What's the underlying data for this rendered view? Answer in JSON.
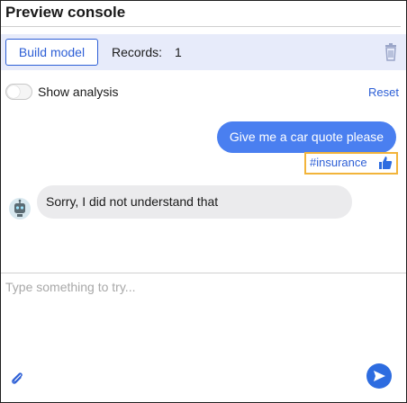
{
  "panel": {
    "title": "Preview console"
  },
  "toolbar": {
    "build_label": "Build model",
    "records_label": "Records:",
    "records_count": "1",
    "delete_icon": "trash-icon"
  },
  "analysis": {
    "toggle_label": "Show analysis",
    "toggle_on": false,
    "reset_label": "Reset"
  },
  "conversation": {
    "user_message": "Give me a car quote please",
    "intent_tag": "#insurance",
    "intent_icon": "thumbs-up-icon",
    "bot_message": "Sorry, I did not understand that",
    "bot_icon": "robot-avatar-icon"
  },
  "composer": {
    "placeholder": "Type something to try...",
    "attach_icon": "paperclip-icon",
    "send_icon": "send-icon"
  },
  "colors": {
    "accent": "#2d5fd6",
    "user_bubble": "#4a7ff0",
    "bot_bubble": "#ebebed",
    "toolbar_bg": "#e7ebfa",
    "highlight_border": "#f2b43a"
  }
}
